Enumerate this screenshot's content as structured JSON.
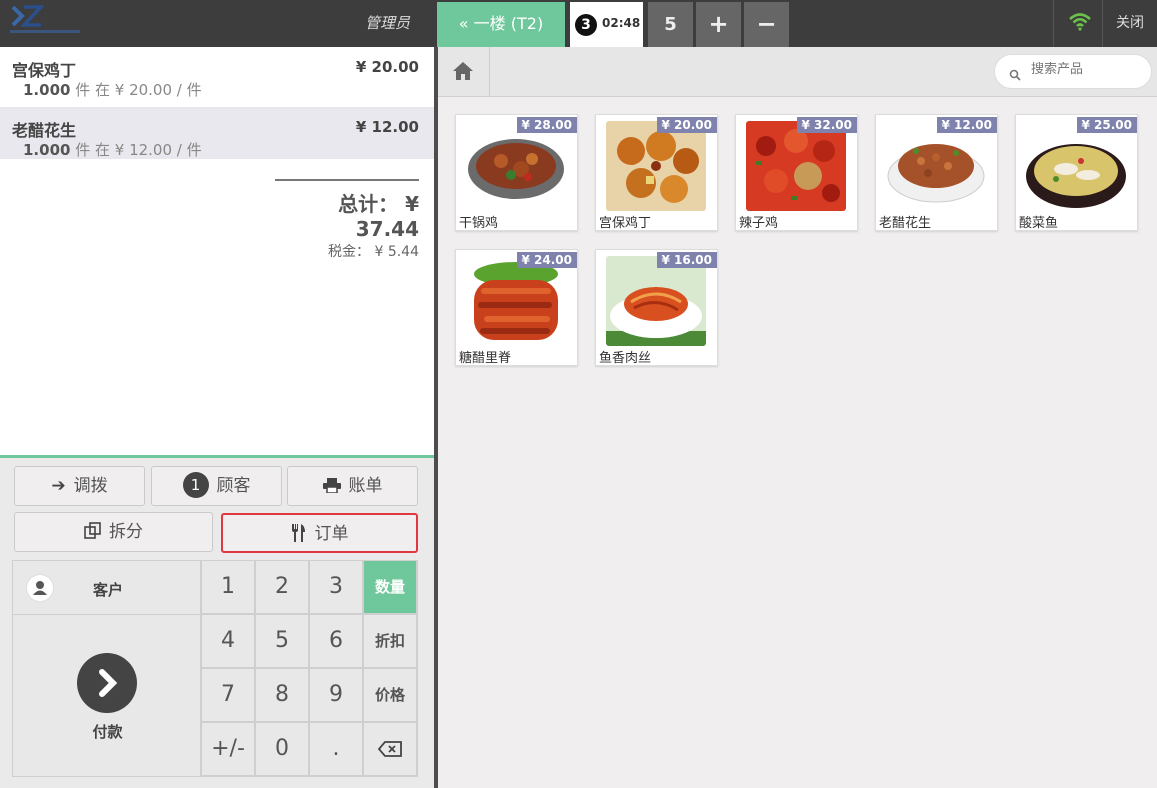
{
  "topbar": {
    "cashier": "管理员",
    "floor_button": "« 一楼 (T2)",
    "order_tab": {
      "number": "3",
      "time": "02:48"
    },
    "order_count": "5",
    "add_label": "+",
    "remove_label": "−",
    "close_label": "关闭"
  },
  "orderlines": [
    {
      "name": "宫保鸡丁",
      "price": "¥ 20.00",
      "qty": "1.000",
      "unit_text": " 件 在 ¥ 20.00 / 件"
    },
    {
      "name": "老醋花生",
      "price": "¥ 12.00",
      "qty": "1.000",
      "unit_text": " 件 在 ¥ 12.00 / 件"
    }
  ],
  "summary": {
    "total": "总计： ¥ 37.44",
    "tax": "税金： ¥ 5.44"
  },
  "actions": {
    "transfer": "调拨",
    "guests_count": "1",
    "guests": "顾客",
    "bill": "账单",
    "split": "拆分",
    "order": "订单"
  },
  "numpad": {
    "customer": "客户",
    "payment": "付款",
    "keys": [
      "1",
      "2",
      "3",
      "4",
      "5",
      "6",
      "7",
      "8",
      "9",
      "+/-",
      "0",
      "."
    ],
    "modes": [
      "数量",
      "折扣",
      "价格"
    ],
    "active_mode": "数量"
  },
  "search": {
    "placeholder": "搜索产品"
  },
  "products": [
    {
      "name": "干锅鸡",
      "price": "¥ 28.00"
    },
    {
      "name": "宫保鸡丁",
      "price": "¥ 20.00"
    },
    {
      "name": "辣子鸡",
      "price": "¥ 32.00"
    },
    {
      "name": "老醋花生",
      "price": "¥ 12.00"
    },
    {
      "name": "酸菜鱼",
      "price": "¥ 25.00"
    },
    {
      "name": "糖醋里脊",
      "price": "¥ 24.00"
    },
    {
      "name": "鱼香肉丝",
      "price": "¥ 16.00"
    }
  ],
  "colors": {
    "accent": "#6ec89b",
    "topbar": "#3d3d3d",
    "price_tag": "#7f82ac",
    "highlight_border": "#e0383e"
  }
}
